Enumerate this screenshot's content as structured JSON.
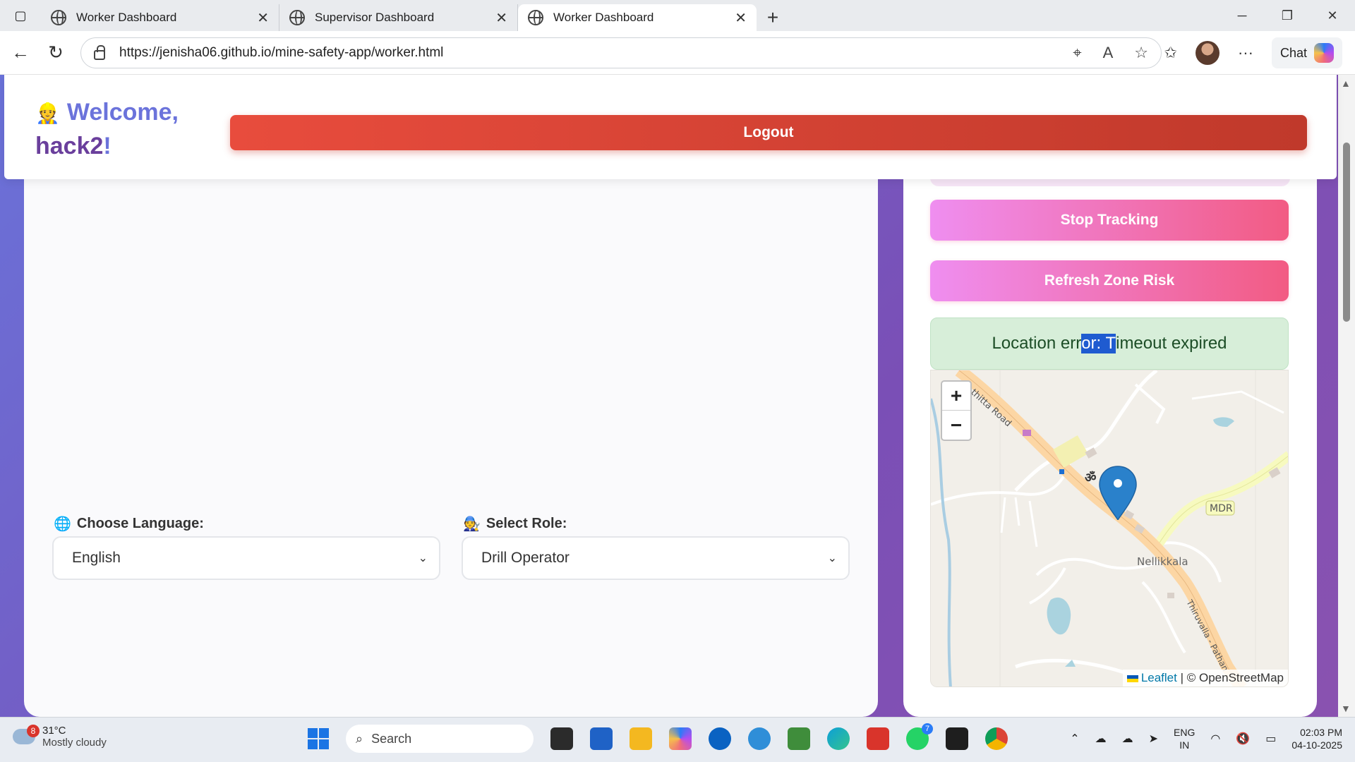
{
  "browser": {
    "tabs": [
      {
        "title": "Worker Dashboard",
        "active": false
      },
      {
        "title": "Supervisor Dashboard",
        "active": false
      },
      {
        "title": "Worker Dashboard",
        "active": true
      }
    ],
    "url": "https://jenisha06.github.io/mine-safety-app/worker.html",
    "chat_label": "Chat"
  },
  "header": {
    "emoji": "👷",
    "welcome_text": "Welcome,",
    "username": "hack2",
    "exclaim": "!",
    "logout_label": "Logout"
  },
  "controls": {
    "stop_tracking_label": "Stop Tracking",
    "refresh_zone_label": "Refresh Zone Risk"
  },
  "status": {
    "prefix": "Location err",
    "selected": "or: T",
    "suffix": "imeout expired"
  },
  "map": {
    "zoom_in": "+",
    "zoom_out": "−",
    "labels": {
      "road_top": "thitta Road",
      "mdr": "MDR",
      "place": "Nellikkala",
      "road_bottom": "Thiruvalla - Pathan"
    },
    "attribution_leaflet": "Leaflet",
    "attribution_osm": "| © OpenStreetMap"
  },
  "language": {
    "label": "Choose Language:",
    "selected": "English"
  },
  "role": {
    "label": "Select Role:",
    "selected": "Drill Operator"
  },
  "taskbar": {
    "weather_temp": "31°C",
    "weather_desc": "Mostly cloudy",
    "weather_badge": "8",
    "search_label": "Search",
    "whatsapp_badge": "7",
    "lang_line1": "ENG",
    "lang_line2": "IN",
    "time": "02:03 PM",
    "date": "04-10-2025"
  },
  "colors": {
    "accent_purple": "#6b73db",
    "logout_red": "#e84c3d",
    "button_pink": "#f25b83",
    "status_green_bg": "#d7eed9"
  }
}
